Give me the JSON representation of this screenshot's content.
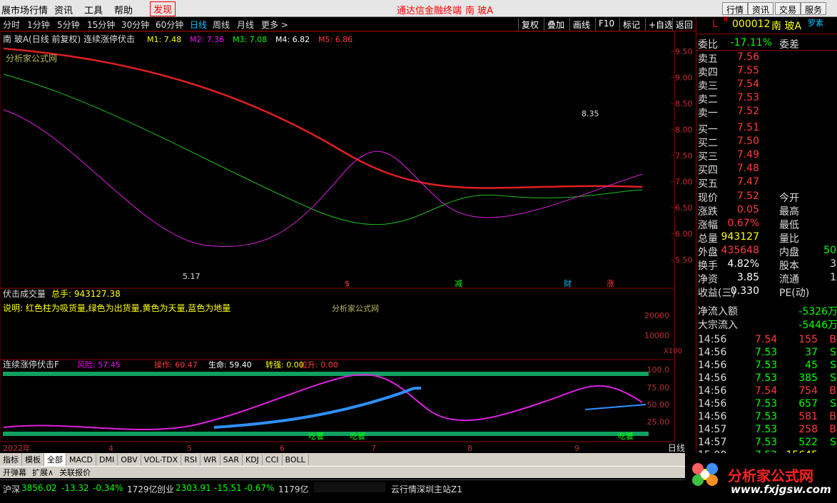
{
  "menubar": {
    "items": [
      "展市场行情",
      "资讯",
      "工具",
      "帮助"
    ],
    "highlight": "发现",
    "center_title": "通达信金融终端",
    "center_stock": "南 玻A",
    "right_buttons": [
      "行情",
      "资讯",
      "交易",
      "服务"
    ]
  },
  "toolbar": {
    "periods": [
      "分时",
      "1分钟",
      "5分钟",
      "15分钟",
      "30分钟",
      "60分钟",
      "日线",
      "周线",
      "月线",
      "更多 >"
    ],
    "active": "日线",
    "buttons": [
      "复权",
      "叠加",
      "画线",
      "F10",
      "标记",
      "+自选",
      "返回"
    ]
  },
  "main": {
    "title": "南 玻A(日线 前复权) 连续涨停伏击",
    "ma": [
      {
        "label": "M1: 7.48",
        "color": "#ffff00"
      },
      {
        "label": "M2: 7.36",
        "color": "#ff00ff"
      },
      {
        "label": "M3: 7.08",
        "color": "#00ff00"
      },
      {
        "label": "M4: 6.82",
        "color": "#ffffff"
      },
      {
        "label": "M5: 6.86",
        "color": "#ff3b3b"
      }
    ],
    "watermark": "分析家公式网",
    "high_label": "8.35",
    "low_label": "5.17",
    "markers": [
      {
        "t": "$",
        "c": "#ff3b3b"
      },
      {
        "t": "减",
        "c": "#00ff00"
      },
      {
        "t": "财",
        "c": "#00c0ff"
      },
      {
        "t": "涨",
        "c": "#ff3b3b"
      }
    ]
  },
  "vol": {
    "title": "伏击成交量",
    "total": "总手: 943127.38",
    "desc": "说明: 红色柱为吸货量,绿色为出货量,黄色为天量,蓝色为地量",
    "watermark": "分析家公式网",
    "axis": [
      "20000",
      "10000",
      "X100"
    ]
  },
  "ind": {
    "title": "连续涨停伏击F",
    "items": [
      {
        "label": "风险: 57.45",
        "color": "#ff00ff"
      },
      {
        "label": "操作: 60.47",
        "color": "#ff3b3b"
      },
      {
        "label": "生命: 59.40",
        "color": "#ffffff"
      },
      {
        "label": "转强: 0.00",
        "color": "#ffff00"
      },
      {
        "label": "拉升: 0.00",
        "color": "#ff3b3b"
      }
    ],
    "axis": [
      "100.0",
      "75.00",
      "50.00",
      "25.00"
    ],
    "labels": [
      "吃饕",
      "吃饕",
      "吃饕"
    ]
  },
  "xaxis": {
    "labels": [
      "2022年",
      "4",
      "5",
      "6",
      "7",
      "8",
      "9"
    ],
    "right": "日线"
  },
  "price_axis": [
    "9.50",
    "9.00",
    "8.50",
    "8.00",
    "7.50",
    "7.00",
    "6.50",
    "6.00",
    "5.50"
  ],
  "quote": {
    "code": "000012",
    "name": "南 玻A",
    "tag": "罗素",
    "weibi": "委比",
    "weibi_val": "-17.11%",
    "weicha": "委差",
    "asks": [
      {
        "l": "卖五",
        "v": "7.56"
      },
      {
        "l": "卖四",
        "v": "7.55"
      },
      {
        "l": "卖三",
        "v": "7.54"
      },
      {
        "l": "卖二",
        "v": "7.53"
      },
      {
        "l": "卖一",
        "v": "7.52"
      }
    ],
    "bids": [
      {
        "l": "买一",
        "v": "7.51"
      },
      {
        "l": "买二",
        "v": "7.50"
      },
      {
        "l": "买三",
        "v": "7.49"
      },
      {
        "l": "买四",
        "v": "7.48"
      },
      {
        "l": "买五",
        "v": "7.47"
      }
    ],
    "stats": [
      {
        "l": "现价",
        "v": "7.52",
        "r": "今开",
        "c": "red"
      },
      {
        "l": "涨跌",
        "v": "0.05",
        "r": "最高",
        "c": "red"
      },
      {
        "l": "涨幅",
        "v": "0.67%",
        "r": "最低",
        "c": "red"
      },
      {
        "l": "总量",
        "v": "943127",
        "r": "量比",
        "c": "yel"
      },
      {
        "l": "外盘",
        "v": "435648",
        "r": "内盘",
        "c": "red",
        "extra": "50"
      },
      {
        "l": "换手",
        "v": "4.82%",
        "r": "股本",
        "c": "wht",
        "extra": "3"
      },
      {
        "l": "净资",
        "v": "3.85",
        "r": "流通",
        "c": "wht",
        "extra": "1"
      },
      {
        "l": "收益(三)",
        "v": "0.330",
        "r": "PE(动)",
        "c": "wht"
      }
    ],
    "flow": [
      {
        "l": "净流入额",
        "v": "-5326万"
      },
      {
        "l": "大宗流入",
        "v": "-5446万"
      }
    ],
    "ticks": [
      {
        "t": "14:56",
        "p": "7.54",
        "v": "155",
        "s": "B"
      },
      {
        "t": "14:56",
        "p": "7.53",
        "v": "37",
        "s": "S"
      },
      {
        "t": "14:56",
        "p": "7.53",
        "v": "45",
        "s": "S"
      },
      {
        "t": "14:56",
        "p": "7.53",
        "v": "385",
        "s": "S"
      },
      {
        "t": "14:56",
        "p": "7.54",
        "v": "754",
        "s": "B"
      },
      {
        "t": "14:56",
        "p": "7.53",
        "v": "657",
        "s": "S"
      },
      {
        "t": "14:56",
        "p": "7.53",
        "v": "581",
        "s": "B"
      },
      {
        "t": "14:57",
        "p": "7.53",
        "v": "258",
        "s": "B"
      },
      {
        "t": "14:57",
        "p": "7.53",
        "v": "522",
        "s": "S"
      },
      {
        "t": "15:00",
        "p": "7.52",
        "v": "15645",
        "s": ""
      }
    ]
  },
  "bottom_tabs": [
    "指标",
    "模板",
    "全部",
    "MACD",
    "DMI",
    "OBV",
    "VOL-TDX",
    "RSI",
    "WR",
    "SAR",
    "KDJ",
    "CCI",
    "BOLL"
  ],
  "bottom_tabs2": [
    "开弹幕",
    "扩展∧",
    "关联报价"
  ],
  "status": {
    "sh_label": "沪深",
    "sh_val": "3856.02",
    "sh_chg": "-13.32",
    "sh_pct": "-0.34%",
    "sh_amt": "1729亿",
    "cy_label": "创业",
    "cy_val": "2303.91",
    "cy_chg": "-15.51",
    "cy_pct": "-0.67%",
    "cy_amt": "1179亿",
    "server": "云行情深圳主站Z1"
  },
  "logo": {
    "main": "分析家公式网",
    "url": "www.fxjgsw.com"
  }
}
